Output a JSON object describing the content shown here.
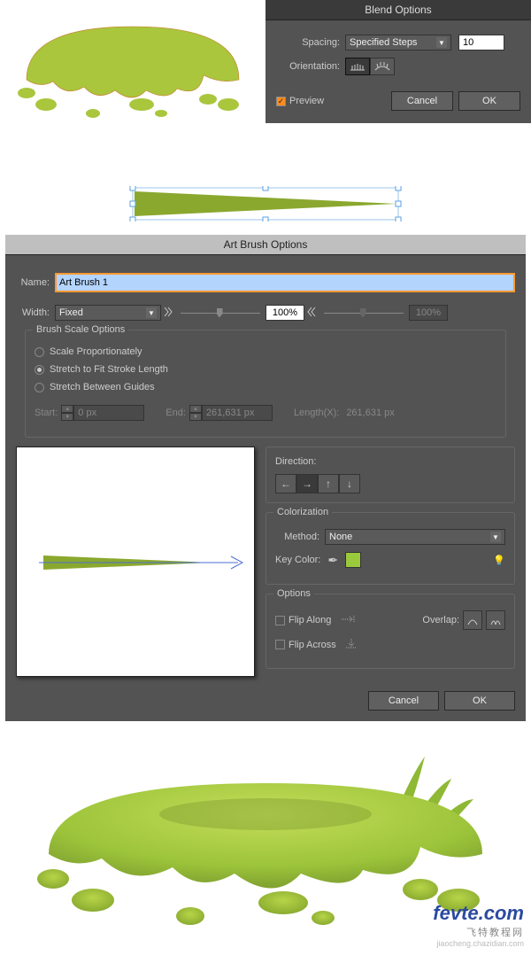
{
  "blend": {
    "title": "Blend Options",
    "spacing_label": "Spacing:",
    "spacing_mode": "Specified Steps",
    "spacing_value": "10",
    "orientation_label": "Orientation:",
    "preview_label": "Preview",
    "preview_checked": true,
    "cancel": "Cancel",
    "ok": "OK"
  },
  "artbrush": {
    "title": "Art Brush Options",
    "name_label": "Name:",
    "name_value": "Art Brush 1",
    "width_label": "Width:",
    "width_mode": "Fixed",
    "width_pct1": "100%",
    "width_pct2": "100%",
    "scale": {
      "title": "Brush Scale Options",
      "opt1": "Scale Proportionately",
      "opt2": "Stretch to Fit Stroke Length",
      "opt3": "Stretch Between Guides",
      "start_label": "Start:",
      "start_value": "0 px",
      "end_label": "End:",
      "end_value": "261,631 px",
      "lenx_label": "Length(X):",
      "lenx_value": "261,631 px"
    },
    "direction": {
      "title": "Direction:"
    },
    "colorization": {
      "title": "Colorization",
      "method_label": "Method:",
      "method_value": "None",
      "keycolor_label": "Key Color:"
    },
    "options": {
      "title": "Options",
      "flip_along": "Flip Along",
      "flip_across": "Flip Across",
      "overlap_label": "Overlap:"
    },
    "cancel": "Cancel",
    "ok": "OK"
  },
  "watermark": {
    "main": "fevte.com",
    "sub": "飞特教程网",
    "url": "jiaocheng.chazidian.com"
  }
}
